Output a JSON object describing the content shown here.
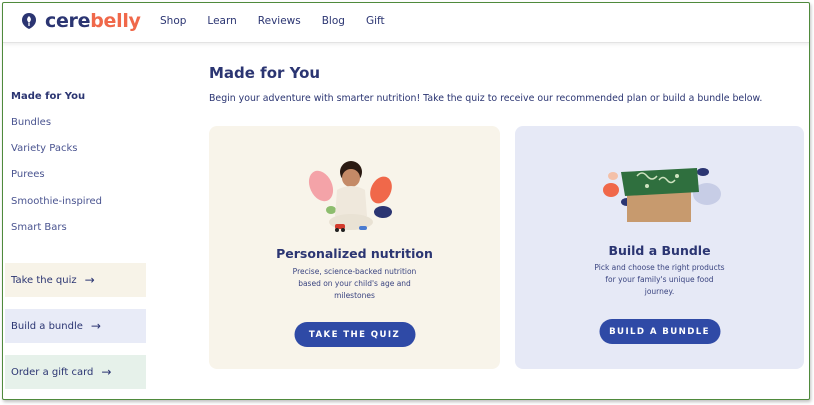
{
  "brand": {
    "name_part1": "cere",
    "name_part2": "belly",
    "accent": "#f0684a",
    "primary": "#2b3572"
  },
  "nav": {
    "items": [
      "Shop",
      "Learn",
      "Reviews",
      "Blog",
      "Gift"
    ]
  },
  "sidebar": {
    "title": "Made for You",
    "links": [
      "Bundles",
      "Variety Packs",
      "Purees",
      "Smoothie-inspired",
      "Smart Bars"
    ],
    "ctas": [
      {
        "label": "Take the quiz",
        "arrow": "→",
        "color": "#f7f3e8"
      },
      {
        "label": "Build a bundle",
        "arrow": "→",
        "color": "#e8ebf7"
      },
      {
        "label": "Order a gift card",
        "arrow": "→",
        "color": "#e6f1ea"
      }
    ]
  },
  "main": {
    "title": "Made for You",
    "subtitle": "Begin your adventure with smarter nutrition! Take the quiz to receive our recommended plan or build a bundle below."
  },
  "cards": [
    {
      "title": "Personalized nutrition",
      "desc_lines": [
        "Precise, science-backed nutrition",
        "based on your child's age and",
        "milestones"
      ],
      "button": "TAKE THE QUIZ",
      "bg": "#f8f4ea"
    },
    {
      "title": "Build a Bundle",
      "desc_lines": [
        "Pick and choose the right products",
        "for your family's unique food",
        "journey."
      ],
      "button": "BUILD A BUNDLE",
      "bg": "#e6e9f6"
    }
  ]
}
